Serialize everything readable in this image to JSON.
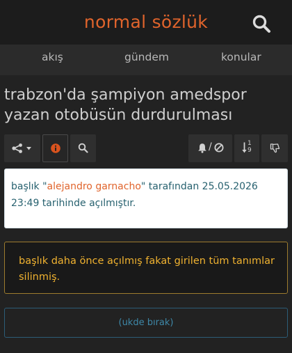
{
  "header": {
    "logo": "normal sözlük",
    "search_icon": "search-icon"
  },
  "nav": {
    "items": [
      {
        "label": "akış"
      },
      {
        "label": "gündem"
      },
      {
        "label": "konular"
      }
    ]
  },
  "topic": {
    "title": "trabzon'da şampiyon amedspor yazan otobüsün durdurulması"
  },
  "toolbar": {
    "share_icon": "share-icon",
    "share_dropdown_icon": "caret-down-icon",
    "info_icon": "info-circle-icon",
    "search_icon": "search-icon",
    "notify_icon": "bell-icon",
    "block_icon": "ban-icon",
    "notify_separator": "/",
    "sort_icon": "sort-numeric-icon",
    "sort_digit_top": "1",
    "sort_digit_bottom": "9",
    "dislike_icon": "thumbs-down-icon"
  },
  "info": {
    "prefix": "başlık \"",
    "author": "alejandro garnacho",
    "suffix": "\" tarafından 25.05.2026 23:49 tarihinde açılmıştır."
  },
  "warning": {
    "text": "başlık daha önce açılmış fakat girilen tüm tanımlar silinmiş."
  },
  "ukde": {
    "label": "(ukde bırak)"
  },
  "colors": {
    "brand": "#e0642c",
    "info_text": "#27616f",
    "warning": "#f0b230",
    "warning_border": "#9d7c2e",
    "ukde": "#3e88a8",
    "ukde_border": "#2c5d78",
    "info_icon": "#d9531e"
  }
}
